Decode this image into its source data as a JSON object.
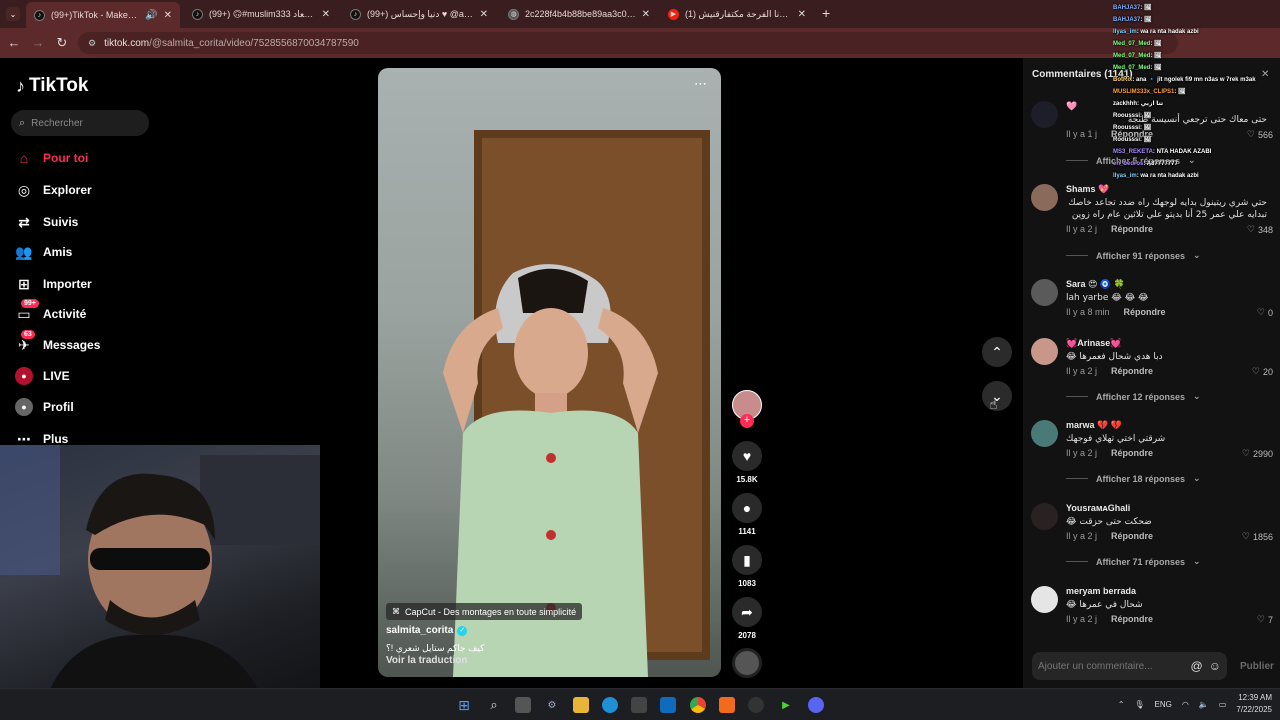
{
  "browser": {
    "tabs": [
      {
        "title": "(99+)TikTok - Make Your Day",
        "active": true
      },
      {
        "title": "(99+) 🙃#muslim333 العاد | TikTok",
        "active": false
      },
      {
        "title": "(99+) دنيا وإحساس ♥ @aihssas",
        "active": false
      },
      {
        "title": "2c228f4b4b88be89aa3c026208",
        "active": false
      },
      {
        "title": "(1) جا آدم ونا الفرحة مكتفارقنيش",
        "active": false
      }
    ],
    "new_tab": "+",
    "url_host": "tiktok.com",
    "url_path": "/@salmita_corita/video/7528556870034787590"
  },
  "sidebar": {
    "logo": "TikTok",
    "search_placeholder": "Rechercher",
    "items": [
      {
        "label": "Pour toi",
        "icon": "home-icon",
        "active": true,
        "badge": ""
      },
      {
        "label": "Explorer",
        "icon": "compass-icon",
        "active": false,
        "badge": ""
      },
      {
        "label": "Suivis",
        "icon": "following-icon",
        "active": false,
        "badge": ""
      },
      {
        "label": "Amis",
        "icon": "friends-icon",
        "active": false,
        "badge": ""
      },
      {
        "label": "Importer",
        "icon": "upload-icon",
        "active": false,
        "badge": ""
      },
      {
        "label": "Activité",
        "icon": "activity-icon",
        "active": false,
        "badge": "99+"
      },
      {
        "label": "Messages",
        "icon": "messages-icon",
        "active": false,
        "badge": "63"
      },
      {
        "label": "LIVE",
        "icon": "live-icon",
        "active": false,
        "badge": ""
      },
      {
        "label": "Profil",
        "icon": "profile-icon",
        "active": false,
        "badge": ""
      },
      {
        "label": "Plus",
        "icon": "more-icon",
        "active": false,
        "badge": ""
      }
    ]
  },
  "video": {
    "capcut": "CapCut - Des montages en toute simplicité",
    "author": "salmita_corita",
    "caption": "كيف جاكم ستايل شعري !؟",
    "translate": "Voir la traduction",
    "likes": "15.8K",
    "comments": "1141",
    "saves": "1083",
    "shares": "2078"
  },
  "comments_panel": {
    "title": "Commentaires (1141)",
    "input_placeholder": "Ajouter un commentaire...",
    "publish": "Publier",
    "reply_label": "Répondre",
    "items": [
      {
        "name": "🩷",
        "text": "حتى معاك حتى ترجعي أنسيسة طنجة",
        "time": "Il y a 1 j",
        "likes": "566",
        "replies": "Afficher 5 réponses"
      },
      {
        "name": "Shams 💖",
        "text": "حتي شري ريتينول بدايه لوجهك راه ضدد تجاعد خاصك تبدايه علي عمر 25 أنا بديتو علي تلاثين عام راه زوين",
        "time": "Il y a 2 j",
        "likes": "348",
        "replies": "Afficher 91 réponses"
      },
      {
        "name": "Sara 😍 🧿 🍀",
        "text": "lah yarbe 😂 😂 😂",
        "time": "Il y a 8 min",
        "likes": "0",
        "replies": ""
      },
      {
        "name": "💓Arinase💓",
        "text": "دبا هدي شحال فعمرها 😂",
        "time": "Il y a 2 j",
        "likes": "20",
        "replies": "Afficher 12 réponses"
      },
      {
        "name": "marwa 💔 💔",
        "text": "شرقتي اختي تهلاي فوجهك",
        "time": "Il y a 2 j",
        "likes": "2990",
        "replies": "Afficher 18 réponses"
      },
      {
        "name": "YousraᴍᴀGhali",
        "text": "ضحكت حتى حزقت 😂",
        "time": "Il y a 2 j",
        "likes": "1856",
        "replies": "Afficher 71 réponses"
      },
      {
        "name": "meryam berrada",
        "text": "شحال في عمرها 😂",
        "time": "Il y a 2 j",
        "likes": "7",
        "replies": ""
      }
    ]
  },
  "chat": [
    {
      "user": "BAHJA37",
      "msg": ": 🖼",
      "color": "#7fb2ff"
    },
    {
      "user": "BAHJA37",
      "msg": ": 🖼",
      "color": "#7fb2ff"
    },
    {
      "user": "Ilyas_im",
      "msg": ": wa ra nta hadak azbi",
      "color": "#7fd3ff"
    },
    {
      "user": "Med_07_Med",
      "msg": ": 🖼",
      "color": "#7dff7d"
    },
    {
      "user": "Med_07_Med",
      "msg": ": 🖼",
      "color": "#7dff7d"
    },
    {
      "user": "Med_07_Med",
      "msg": ": 🖼",
      "color": "#7dff7d"
    },
    {
      "user": "BotRix",
      "msg": ": ana 🔹 jit ngolek fi9 mn n3as w 7rek m3ak",
      "color": "#ffd36b"
    },
    {
      "user": "MUSLIM333x_CLIPS1",
      "msg": ": 🖼",
      "color": "#ff9e3d"
    },
    {
      "user": "zackhhh",
      "msg": ": تتا ازبي",
      "color": "#ffffff"
    },
    {
      "user": "Roousssi",
      "msg": ": 🖼",
      "color": "#ffffff"
    },
    {
      "user": "Roousssi",
      "msg": ": 🖼",
      "color": "#ffffff"
    },
    {
      "user": "Roousssi",
      "msg": ": 🖼",
      "color": "#ffffff"
    },
    {
      "user": "MS3_REKETA",
      "msg": ": NTA HADAK AZABI",
      "color": "#a78bff"
    },
    {
      "user": "eh_bedros",
      "msg": ": A87777777",
      "color": "#a78bff"
    },
    {
      "user": "Ilyas_im",
      "msg": ": wa ra nta hadak azbi",
      "color": "#7fd3ff"
    }
  ],
  "taskbar": {
    "lang": "ENG",
    "time": "12:39 AM",
    "date": "7/22/2025"
  },
  "colors": {
    "accent": "#fe2c55",
    "chrome": "#5c2a2b",
    "panel": "#121212"
  }
}
